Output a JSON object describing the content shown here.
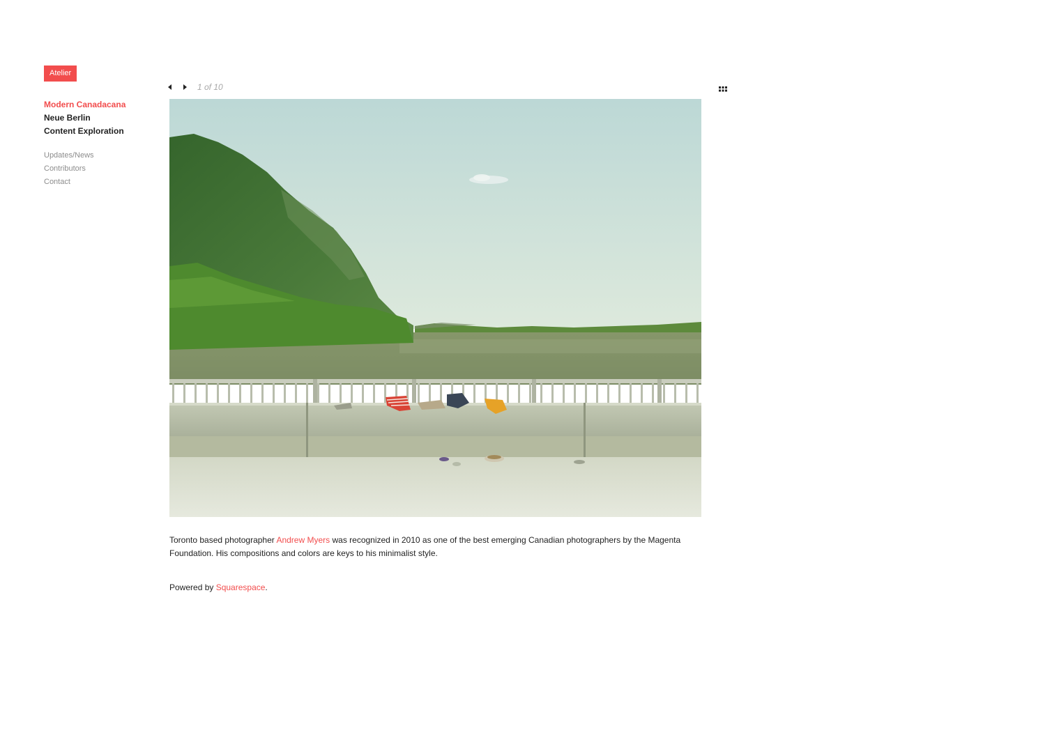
{
  "theme": {
    "accent": "#f24d4d",
    "text": "#222222",
    "muted": "#8c8c8c",
    "counter_text": "#a8a8a8"
  },
  "site": {
    "logo_label": "Atelier"
  },
  "nav": {
    "primary": [
      {
        "label": "Modern Canadacana",
        "active": true
      },
      {
        "label": "Neue Berlin",
        "active": false
      },
      {
        "label": "Content Exploration",
        "active": false
      }
    ],
    "secondary": [
      {
        "label": "Updates/News"
      },
      {
        "label": "Contributors"
      },
      {
        "label": "Contact"
      }
    ]
  },
  "gallery": {
    "prev_icon": "caret-left-icon",
    "next_icon": "caret-right-icon",
    "grid_icon": "grid-icon",
    "counter": "1 of 10",
    "current": 1,
    "total": 10
  },
  "caption": {
    "before": "Toronto based photographer ",
    "link_text": "Andrew Myers",
    "after": " was recognized in 2010 as one of the best emerging Canadian photographers by the Magenta Foundation. His compositions and colors are keys to his minimalist style."
  },
  "footer": {
    "prefix": "Powered by ",
    "link_text": "Squarespace",
    "suffix": "."
  }
}
